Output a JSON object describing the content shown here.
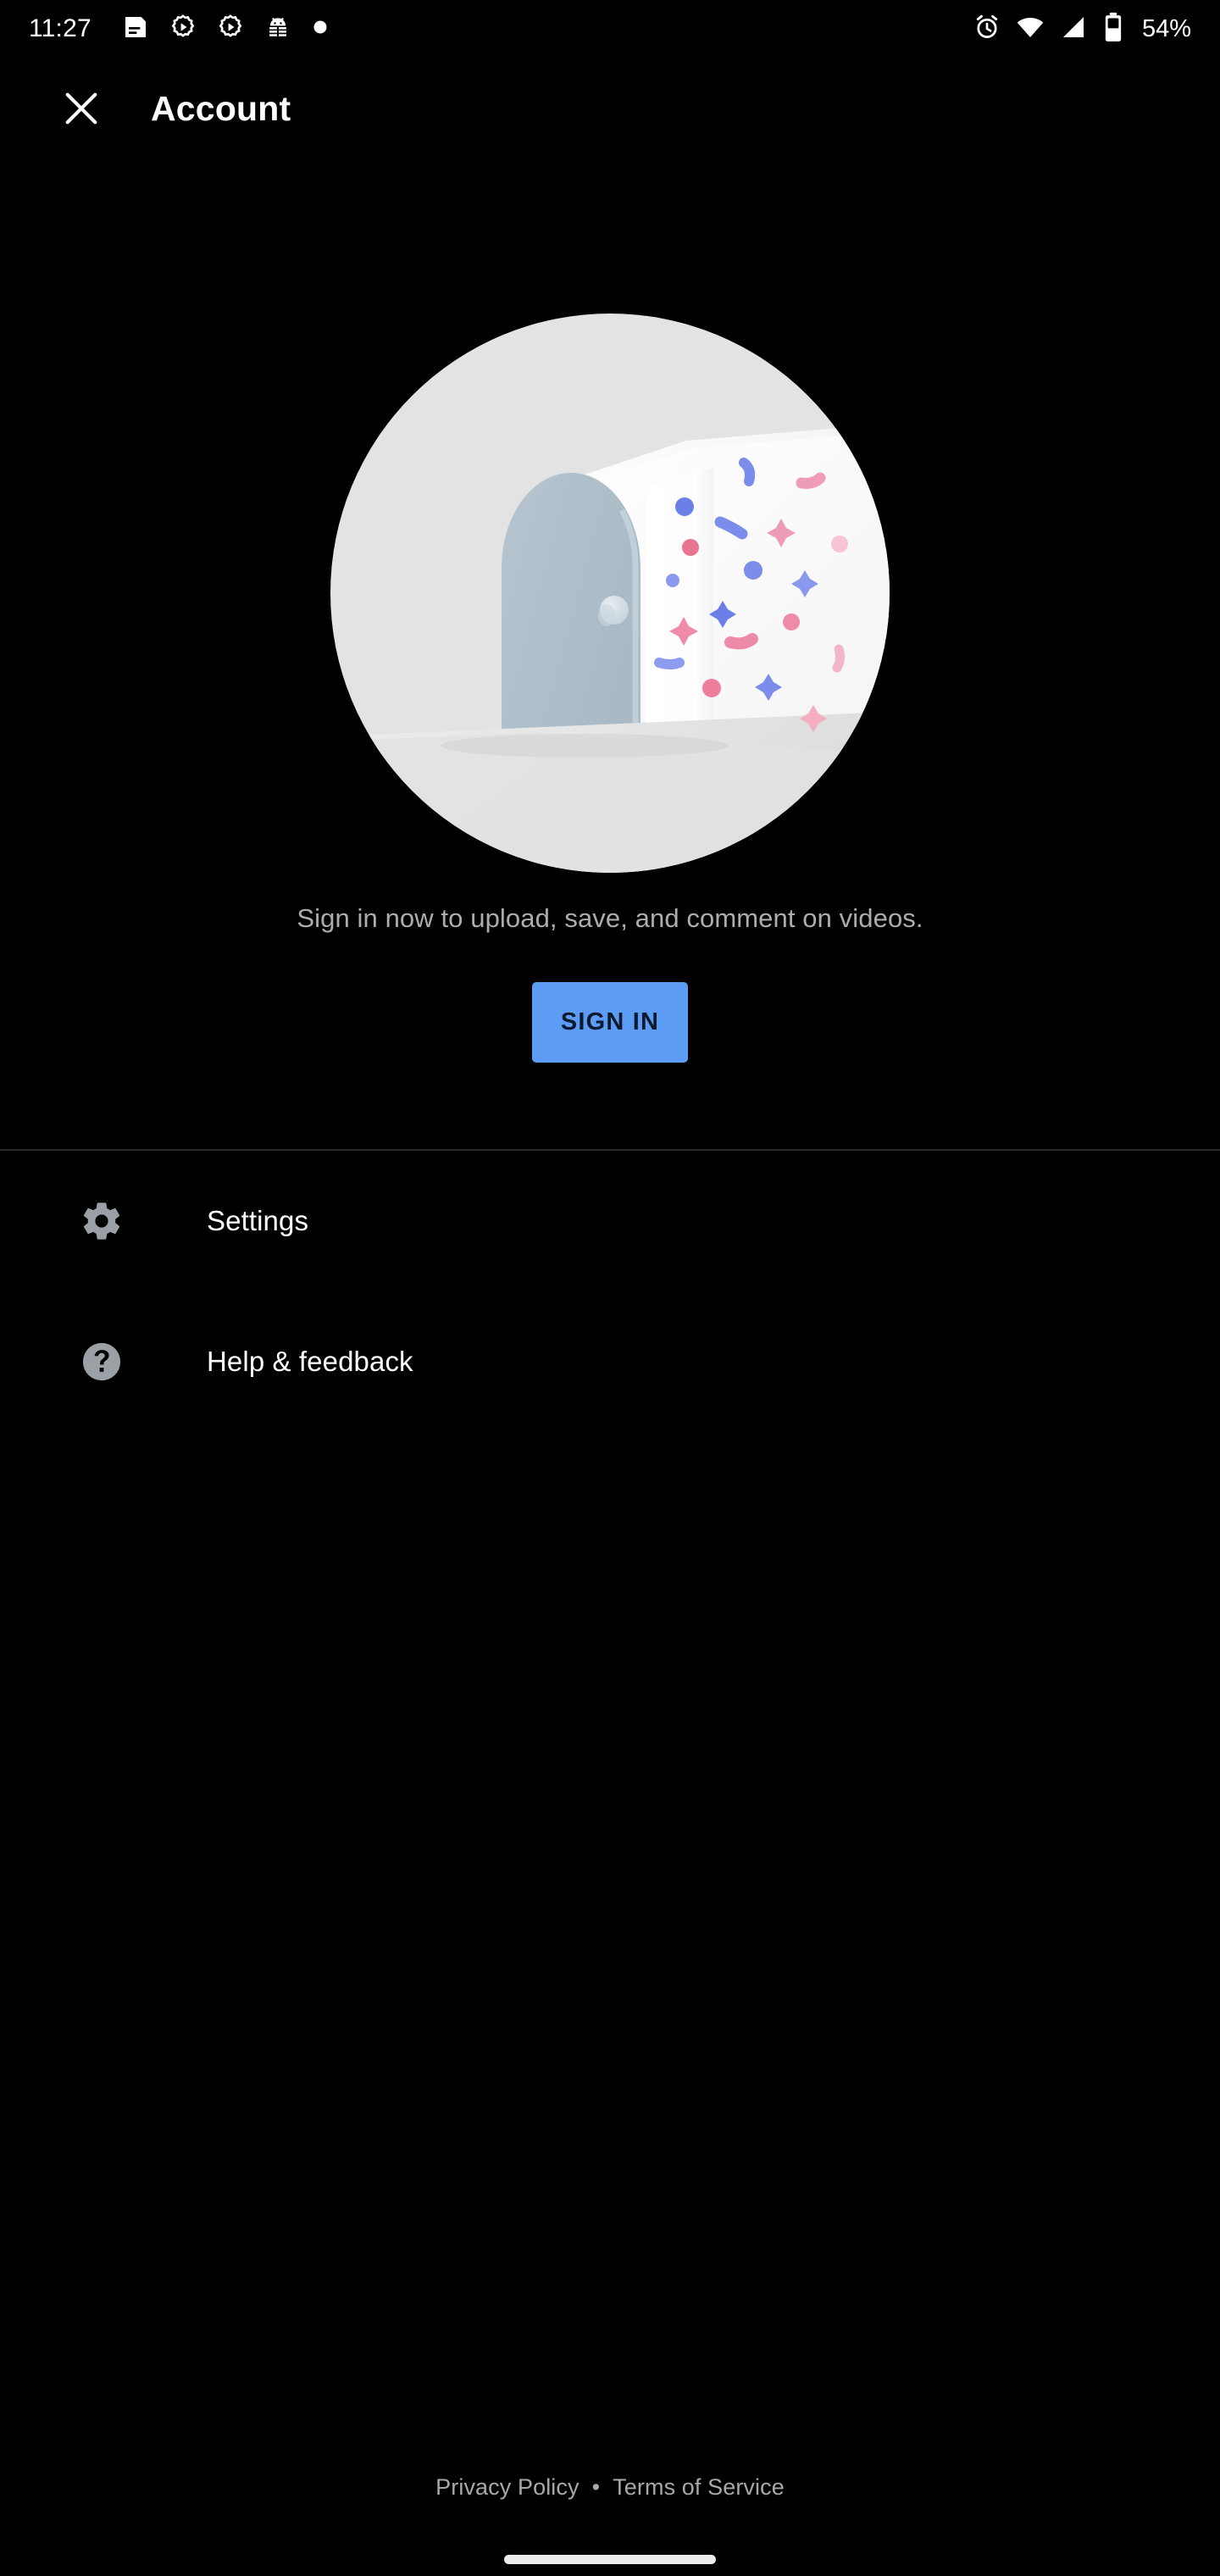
{
  "status_bar": {
    "time": "11:27",
    "battery_percent": "54%",
    "notification_icons": [
      {
        "name": "description-icon"
      },
      {
        "name": "google-play-settings-icon"
      },
      {
        "name": "google-play-settings-icon-2"
      },
      {
        "name": "android-debug-icon"
      },
      {
        "name": "dot-notification-icon"
      }
    ],
    "system_icons": [
      {
        "name": "alarm-icon"
      },
      {
        "name": "wifi-icon"
      },
      {
        "name": "cellular-signal-icon"
      },
      {
        "name": "battery-icon"
      }
    ]
  },
  "header": {
    "close_label": "Close",
    "title": "Account"
  },
  "hero": {
    "illustration_name": "open-door-confetti-illustration",
    "caption": "Sign in now to upload, save, and comment on videos.",
    "sign_in_label": "SIGN IN"
  },
  "menu": {
    "items": [
      {
        "label": "Settings",
        "icon": "gear-icon"
      },
      {
        "label": "Help & feedback",
        "icon": "help-circle-icon"
      }
    ]
  },
  "footer": {
    "privacy_label": "Privacy Policy",
    "separator": "•",
    "terms_label": "Terms of Service"
  },
  "colors": {
    "background": "#000000",
    "accent_button": "#5d9cf5",
    "button_text": "#0b1a2e",
    "primary_text": "#ffffff",
    "secondary_text": "#adadad",
    "footer_text": "#a8a8a8",
    "divider": "#2c2c2c",
    "illustration_circle": "#e3e3e3",
    "door": "#b2c2cd",
    "confetti_blue": "#7b8ceb",
    "confetti_pink": "#ef9cb6",
    "menu_icon": "#9aa0a6",
    "gesture_bar": "#ededed"
  }
}
